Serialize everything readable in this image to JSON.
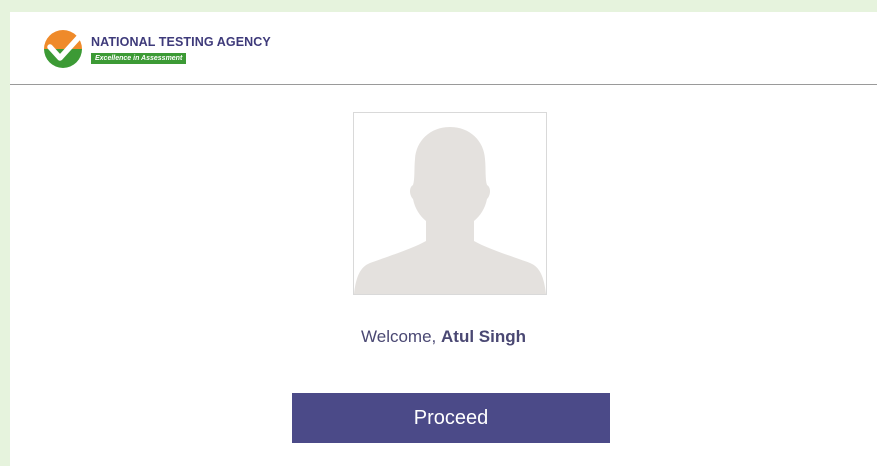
{
  "header": {
    "brand_name": "NATIONAL TESTING AGENCY",
    "tagline": "Excellence in Assessment",
    "logo_icon": "nta-checkmark-logo-icon"
  },
  "main": {
    "avatar_icon": "user-silhouette-icon",
    "welcome_prefix": "Welcome, ",
    "user_name": "Atul Singh",
    "proceed_label": "Proceed"
  },
  "colors": {
    "page_background": "#e6f3dd",
    "brand_text": "#3e3a7a",
    "tagline_background": "#3c9a35",
    "logo_orange": "#ef8a2a",
    "logo_green": "#3c9a35",
    "silhouette": "#e4e1de",
    "welcome_text": "#4a4873",
    "button_background": "#4b4a88",
    "button_text": "#ffffff"
  }
}
